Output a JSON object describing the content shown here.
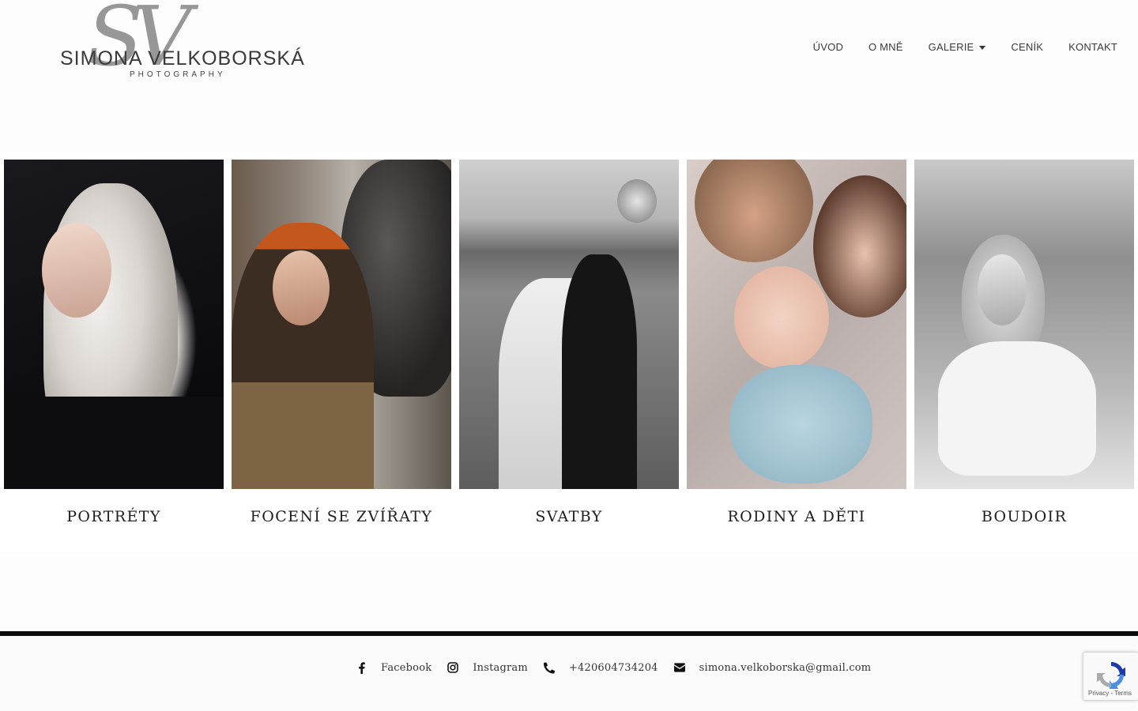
{
  "brand": {
    "monogram": "SV",
    "name": "SIMONA VELKOBORSKÁ",
    "tagline": "PHOTOGRAPHY"
  },
  "nav": {
    "items": [
      {
        "label": "ÚVOD"
      },
      {
        "label": "O MNĚ"
      },
      {
        "label": "GALERIE"
      },
      {
        "label": "CENÍK"
      },
      {
        "label": "KONTAKT"
      }
    ]
  },
  "gallery": {
    "cards": [
      {
        "caption": "PORTRÉTY"
      },
      {
        "caption": "FOCENÍ SE ZVÍŘATY"
      },
      {
        "caption": "SVATBY"
      },
      {
        "caption": "RODINY A DĚTI"
      },
      {
        "caption": "BOUDOIR"
      }
    ]
  },
  "footer": {
    "facebook": "Facebook",
    "instagram": "Instagram",
    "phone": "+420604734204",
    "email": "simona.velkoborska@gmail.com"
  },
  "recaptcha": {
    "privacy": "Privacy",
    "sep": " - ",
    "terms": "Terms"
  },
  "colors": {
    "background": "#fdfdfd",
    "footer_bar": "#0c0c0c",
    "text": "#222222"
  }
}
